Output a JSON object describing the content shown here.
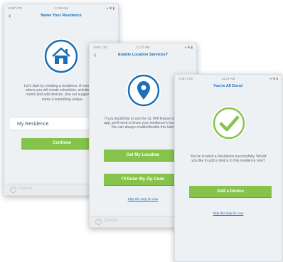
{
  "colors": {
    "accent_blue": "#1a6fb6",
    "button_green": "#86c34a",
    "screen_bg": "#eef1f4"
  },
  "screens": [
    {
      "status": {
        "carrier": "AT&T LTE",
        "time": "11:26 AM"
      },
      "title": "Name Your Residence",
      "icon": "house-icon",
      "text": "Let's start by creating a residence. A residence is where you will create schedules, activities, and rooms and add devices. Use our suggestion or name it something unique.",
      "input_value": "My Residence",
      "button": "Continue",
      "cancel": "Cancel"
    },
    {
      "status": {
        "carrier": "AT&T LTE",
        "time": "11:27 AM"
      },
      "title": "Enable Location Services?",
      "icon": "location-pin-icon",
      "text": "If you would like to use the SL Wifi feature of this app, we'll need to know your residence's location. You can always enable/disable this later.",
      "button_primary": "Get My Location",
      "button_secondary": "I'll Enter My Zip Code",
      "skip": "Skip this step for now",
      "cancel": "Cancel"
    },
    {
      "status": {
        "carrier": "AT&T LTE",
        "time": "11:27 AM"
      },
      "title": "You're All Done!",
      "icon": "checkmark-icon",
      "text": "You've created a Residence successfully. Would you like to add a device to this residence now?",
      "button": "Add a Device",
      "skip": "Skip this step for now"
    }
  ]
}
